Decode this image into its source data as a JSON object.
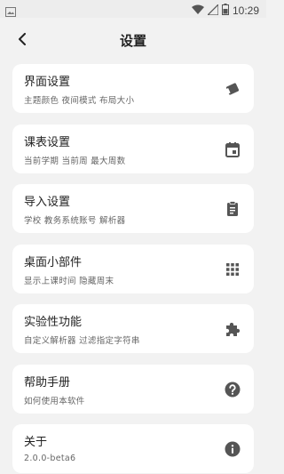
{
  "status_bar": {
    "time": "10:29",
    "icons": [
      "image-icon",
      "wifi-icon",
      "signal-icon",
      "battery-icon"
    ]
  },
  "app_bar": {
    "title": "设置",
    "back_icon": "back-arrow-icon"
  },
  "items": [
    {
      "label": "界面设置",
      "desc": "主题颜色 夜间模式 布局大小",
      "icon": "palette-icon"
    },
    {
      "label": "课表设置",
      "desc": "当前学期 当前周 最大周数",
      "icon": "calendar-icon"
    },
    {
      "label": "导入设置",
      "desc": "学校 教务系统账号 解析器",
      "icon": "clipboard-icon"
    },
    {
      "label": "桌面小部件",
      "desc": "显示上课时间 隐藏周末",
      "icon": "apps-grid-icon"
    },
    {
      "label": "实验性功能",
      "desc": "自定义解析器 过滤指定字符串",
      "icon": "puzzle-icon"
    },
    {
      "label": "帮助手册",
      "desc": "如何使用本软件",
      "icon": "help-icon"
    },
    {
      "label": "关于",
      "desc": "2.0.0-beta6",
      "icon": "info-icon"
    }
  ],
  "colors": {
    "background": "#f2f2f2",
    "card": "#ffffff",
    "icon": "#555555"
  }
}
